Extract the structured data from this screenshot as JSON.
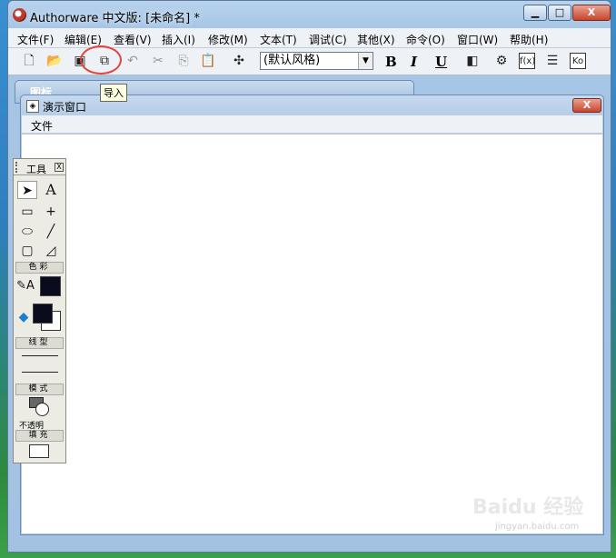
{
  "window": {
    "title": "Authorware 中文版: [未命名] *",
    "min_label": "▁",
    "max_label": "□",
    "close_label": "X"
  },
  "menubar": {
    "items": [
      "文件(F)",
      "编辑(E)",
      "查看(V)",
      "插入(I)",
      "修改(M)",
      "文本(T)",
      "调试(C)",
      "其他(X)",
      "命令(O)",
      "窗口(W)",
      "帮助(H)"
    ]
  },
  "toolbar": {
    "style_value": "(默认风格)",
    "bold": "B",
    "italic": "I",
    "underline": "U",
    "tooltip": "导入"
  },
  "flowchart_window": {
    "title": "图标"
  },
  "presentation_window": {
    "title": "演示窗口",
    "menu_file": "文件",
    "close_label": "X"
  },
  "tool_palette": {
    "title": "工具",
    "close_label": "X",
    "color_section": "色彩",
    "line_section": "线型",
    "mode_section": "模式",
    "mode_value": "不透明",
    "fill_section": "填充"
  },
  "colors": {
    "stroke_color": "#0b0b1e",
    "fill_foreground": "#0b0b1e",
    "fill_background": "#ffffff"
  },
  "watermark": {
    "text": "Baidu 经验",
    "sub": "jingyan.baidu.com"
  }
}
